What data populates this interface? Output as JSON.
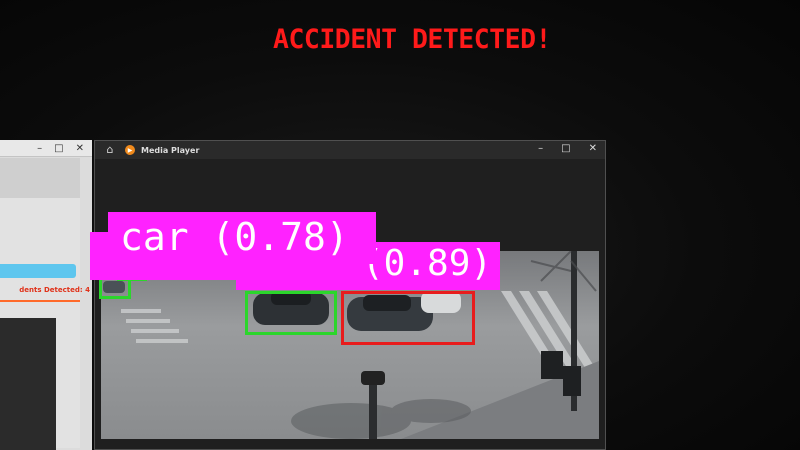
{
  "alert": {
    "text": "ACCIDENT DETECTED!"
  },
  "background_window": {
    "minimize": "–",
    "maximize": "□",
    "close": "✕",
    "status": "dents Detected: 4"
  },
  "media_player": {
    "title": "Media Player",
    "minimize": "–",
    "maximize": "□",
    "close": "✕"
  },
  "detections": {
    "label_1": "car (0.78)",
    "label_2": "(0.89)"
  },
  "colors": {
    "alert": "#ff1a1a",
    "label_background": "#ff22ff",
    "box_normal": "#2bd62b",
    "box_accident": "#e81c1c"
  }
}
